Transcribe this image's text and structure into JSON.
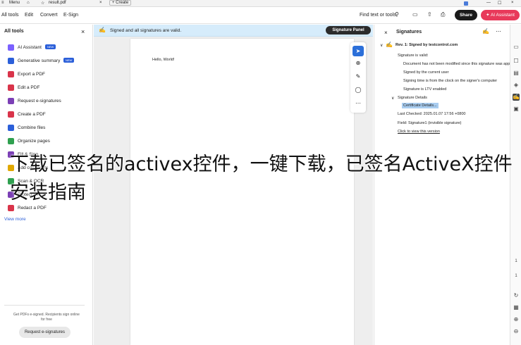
{
  "titlebar": {
    "menu_label": "Menu",
    "tab_title": "result.pdf",
    "create_label": "Create"
  },
  "menubar": {
    "all_tools": "All tools",
    "edit": "Edit",
    "convert": "Convert",
    "esign": "E-Sign",
    "find": "Find text or tools",
    "share": "Share",
    "ai_assistant": "AI Assistant"
  },
  "left_panel": {
    "title": "All tools",
    "items": [
      {
        "label": "AI Assistant",
        "badge": "NEW",
        "color": "#7b61ff"
      },
      {
        "label": "Generative summary",
        "badge": "NEW",
        "color": "#2b5fd9"
      },
      {
        "label": "Export a PDF",
        "color": "#d9344a"
      },
      {
        "label": "Edit a PDF",
        "color": "#d9344a"
      },
      {
        "label": "Request e-signatures",
        "color": "#7b3fb5"
      },
      {
        "label": "Create a PDF",
        "color": "#d9344a"
      },
      {
        "label": "Combine files",
        "color": "#2b5fd9"
      },
      {
        "label": "Organize pages",
        "color": "#2fa04f"
      },
      {
        "label": "Fill & Sign",
        "color": "#7b3fb5"
      },
      {
        "label": "Add comments",
        "color": "#e0a800"
      },
      {
        "label": "Scan & OCR",
        "color": "#2fa04f"
      },
      {
        "label": "Protect a PDF",
        "color": "#7b3fb5"
      },
      {
        "label": "Redact a PDF",
        "color": "#d9344a"
      }
    ],
    "view_more": "View more",
    "promo_text": "Get PDFs e-signed. Recipients sign online for free",
    "promo_button": "Request e-signatures"
  },
  "document": {
    "signed_notice": "Signed and all signatures are valid.",
    "signature_panel_button": "Signature Panel",
    "page_text": "Hello, World!"
  },
  "signatures": {
    "title": "Signatures",
    "rev": "Rev. 1: Signed by testcontrol.com",
    "valid": "Signature is valid:",
    "line1": "Document has not been modified since this signature was applie",
    "line2": "Signed by the current user",
    "line3": "Signing time is from the clock on the signer's computer",
    "line4": "Signature is LTV enabled",
    "details": "Signature Details",
    "cert": "Certificate Details...",
    "last_checked": "Last Checked: 2025.01.07 17:56 +0800",
    "field": "Field: Signature1 (invisible signature)",
    "view_version": "Click to view this version"
  },
  "page_nav": {
    "current": "1",
    "total": "1"
  },
  "watermark": "下载已签名的activex控件，一键下载，已签名ActiveX控件安装指南"
}
